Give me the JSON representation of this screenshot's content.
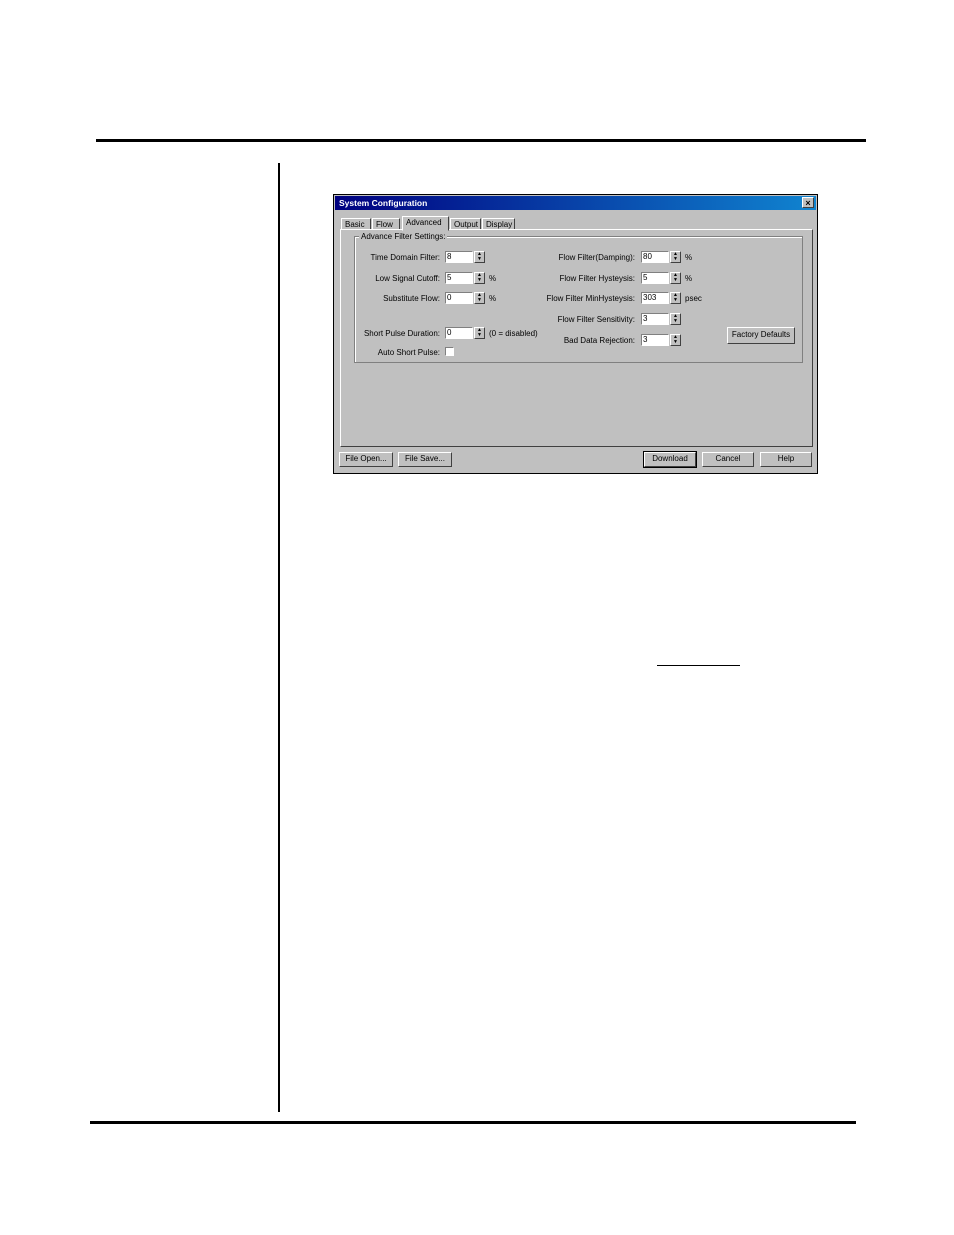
{
  "dialog": {
    "title": "System Configuration",
    "close_label": "×",
    "tabs": [
      {
        "label": "Basic"
      },
      {
        "label": "Flow"
      },
      {
        "label": "Advanced"
      },
      {
        "label": "Output"
      },
      {
        "label": "Display"
      }
    ],
    "group_label": "Advance Filter Settings:",
    "left_fields": {
      "time_domain_filter": {
        "label": "Time Domain Filter:",
        "value": "8"
      },
      "low_signal_cutoff": {
        "label": "Low Signal Cutoff:",
        "value": "5",
        "unit": "%"
      },
      "substitute_flow": {
        "label": "Substitute Flow:",
        "value": "0",
        "unit": "%"
      },
      "short_pulse_duration": {
        "label": "Short Pulse Duration:",
        "value": "0",
        "unit": "(0 = disabled)"
      },
      "auto_short_pulse": {
        "label": "Auto Short Pulse:",
        "checked": false
      }
    },
    "right_fields": {
      "flow_filter_damping": {
        "label": "Flow Filter(Damping):",
        "value": "80",
        "unit": "%"
      },
      "flow_filter_hysteresis": {
        "label": "Flow Filter Hysteysis:",
        "value": "5",
        "unit": "%"
      },
      "flow_filter_min_hysteresis": {
        "label": "Flow Filter MinHysteysis:",
        "value": "303",
        "unit": "psec"
      },
      "flow_filter_sensitivity": {
        "label": "Flow Filter Sensitivity:",
        "value": "3"
      },
      "bad_data_rejection": {
        "label": "Bad Data Rejection:",
        "value": "3"
      }
    },
    "factory_defaults_label": "Factory Defaults",
    "buttons": {
      "file_open": "File Open...",
      "file_save": "File Save...",
      "download": "Download",
      "cancel": "Cancel",
      "help": "Help"
    }
  }
}
